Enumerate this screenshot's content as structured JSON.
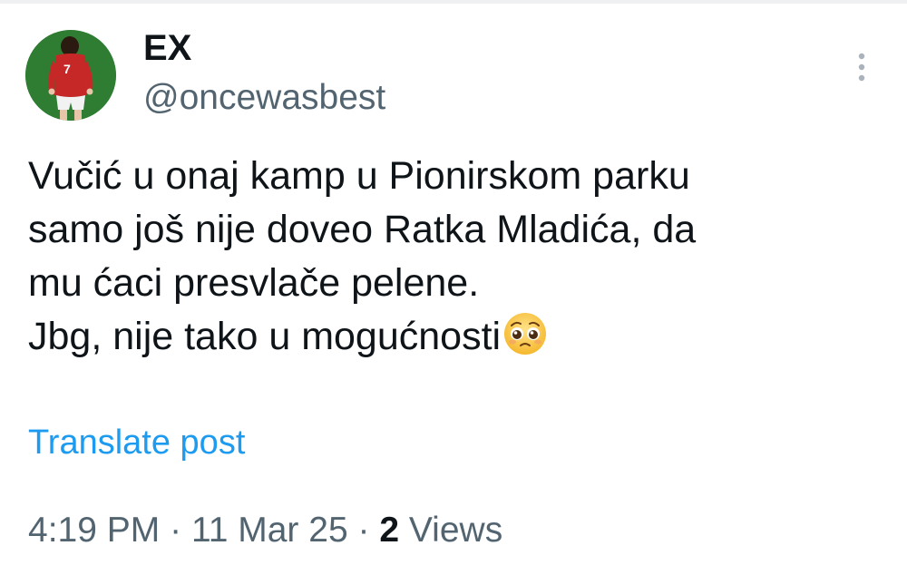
{
  "colors": {
    "text_primary": "#0f1419",
    "text_secondary": "#536471",
    "link": "#1d9bf0",
    "avatar_bg": "#2e7d32",
    "jersey": "#c62828"
  },
  "author": {
    "display_name": "EX",
    "handle": "@oncewasbest",
    "avatar_icon": "footballer-number-7-avatar",
    "jersey_number": "7"
  },
  "menu": {
    "icon": "more-vertical-icon"
  },
  "post": {
    "lines": [
      "Vučić u onaj kamp u Pionirskom parku",
      "samo još nije doveo Ratka Mladića, da",
      "mu ćaci presvlače pelene.",
      "Jbg, nije tako u mogućnosti"
    ],
    "emoji": "pleading-face-emoji"
  },
  "translate_label": "Translate post",
  "meta": {
    "time": "4:19 PM",
    "separator": "·",
    "date": "11 Mar 25",
    "views_count": "2",
    "views_label": "Views"
  }
}
